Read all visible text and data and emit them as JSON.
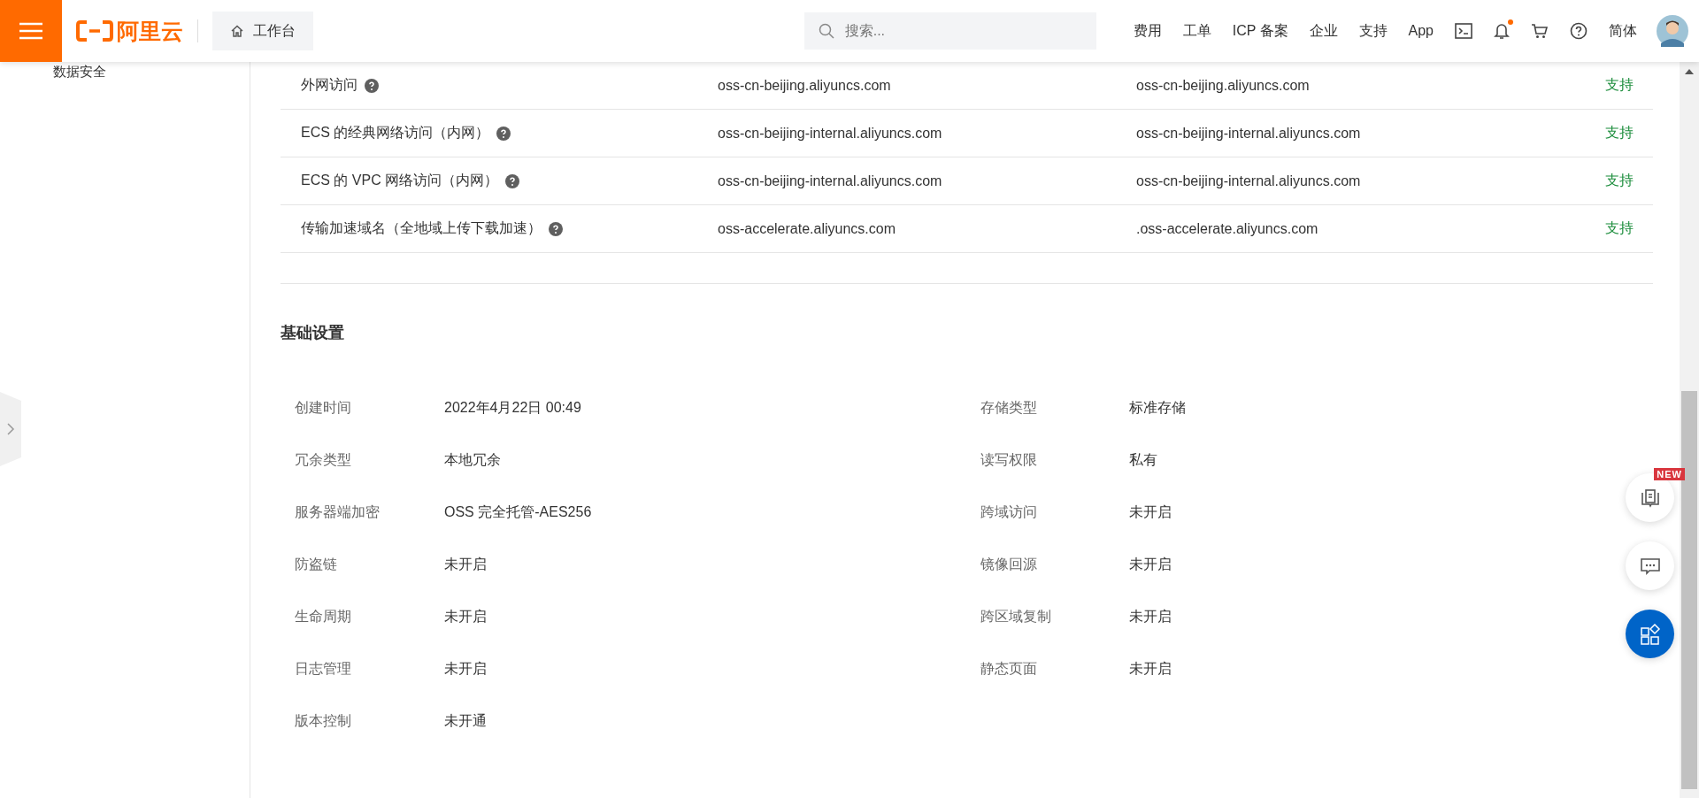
{
  "header": {
    "brand": "阿里云",
    "workbench": "工作台",
    "search": {
      "placeholder": "搜索..."
    },
    "nav": [
      "费用",
      "工单",
      "ICP 备案",
      "企业",
      "支持",
      "App"
    ],
    "notifications_unread": true,
    "language": "简体"
  },
  "sidebar": {
    "items": [
      "数据安全"
    ]
  },
  "endpoints": {
    "rows": [
      {
        "name": "外网访问",
        "endpoint": "oss-cn-beijing.aliyuncs.com",
        "bucket_domain": "oss-cn-beijing.aliyuncs.com",
        "support": "支持"
      },
      {
        "name": "ECS 的经典网络访问（内网）",
        "endpoint": "oss-cn-beijing-internal.aliyuncs.com",
        "bucket_domain": "oss-cn-beijing-internal.aliyuncs.com",
        "support": "支持"
      },
      {
        "name": "ECS 的 VPC 网络访问（内网）",
        "endpoint": "oss-cn-beijing-internal.aliyuncs.com",
        "bucket_domain": "oss-cn-beijing-internal.aliyuncs.com",
        "support": "支持"
      },
      {
        "name": "传输加速域名（全地域上传下载加速）",
        "endpoint": "oss-accelerate.aliyuncs.com",
        "bucket_domain": ".oss-accelerate.aliyuncs.com",
        "support": "支持"
      }
    ]
  },
  "basic_settings": {
    "title": "基础设置",
    "rows": [
      [
        {
          "label": "创建时间",
          "value": "2022年4月22日 00:49"
        },
        {
          "label": "存储类型",
          "value": "标准存储"
        }
      ],
      [
        {
          "label": "冗余类型",
          "value": "本地冗余"
        },
        {
          "label": "读写权限",
          "value": "私有"
        }
      ],
      [
        {
          "label": "服务器端加密",
          "value": "OSS 完全托管-AES256"
        },
        {
          "label": "跨域访问",
          "value": "未开启"
        }
      ],
      [
        {
          "label": "防盗链",
          "value": "未开启"
        },
        {
          "label": "镜像回源",
          "value": "未开启"
        }
      ],
      [
        {
          "label": "生命周期",
          "value": "未开启"
        },
        {
          "label": "跨区域复制",
          "value": "未开启"
        }
      ],
      [
        {
          "label": "日志管理",
          "value": "未开启"
        },
        {
          "label": "静态页面",
          "value": "未开启"
        }
      ],
      [
        {
          "label": "版本控制",
          "value": "未开通"
        }
      ]
    ]
  },
  "float_buttons": [
    {
      "kind": "guide",
      "badge": "NEW"
    },
    {
      "kind": "chat"
    },
    {
      "kind": "apps"
    }
  ]
}
